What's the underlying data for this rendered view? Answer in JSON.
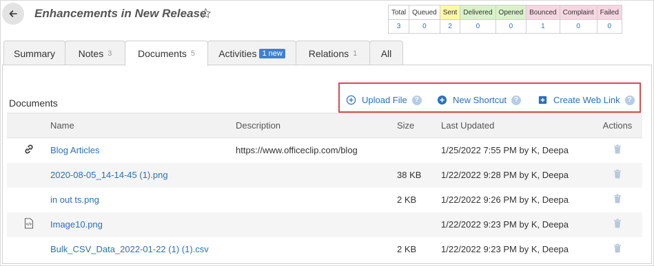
{
  "header": {
    "title": "Enhancements in New Release"
  },
  "stats": {
    "labels": [
      "Total",
      "Queued",
      "Sent",
      "Delivered",
      "Opened",
      "Bounced",
      "Complaint",
      "Failed"
    ],
    "values": [
      "3",
      "0",
      "2",
      "0",
      "0",
      "1",
      "0",
      "0"
    ],
    "colors": [
      "#ffffff",
      "#ffffff",
      "#fff9a6",
      "#d9f2c9",
      "#d9f2c9",
      "#f7d6e2",
      "#f7d6e2",
      "#f7d6e2"
    ]
  },
  "tabs": [
    {
      "label": "Summary",
      "count": ""
    },
    {
      "label": "Notes",
      "count": "3"
    },
    {
      "label": "Documents",
      "count": "5"
    },
    {
      "label": "Activities",
      "badge": "1 new"
    },
    {
      "label": "Relations",
      "count": "1"
    },
    {
      "label": "All",
      "count": ""
    }
  ],
  "documents": {
    "title": "Documents",
    "actions": {
      "upload": "Upload File",
      "shortcut": "New Shortcut",
      "weblink": "Create Web Link"
    },
    "columns": {
      "name": "Name",
      "description": "Description",
      "size": "Size",
      "updated": "Last Updated",
      "actions": "Actions"
    },
    "rows": [
      {
        "icon": "link-icon",
        "name": "Blog Articles",
        "description": "https://www.officeclip.com/blog",
        "size": "",
        "updated": "1/25/2022 7:55 PM by K, Deepa"
      },
      {
        "icon": "",
        "name": "2020-08-05_14-14-45 (1).png",
        "description": "",
        "size": "38 KB",
        "updated": "1/22/2022 9:28 PM by K, Deepa"
      },
      {
        "icon": "",
        "name": "in out ts.png",
        "description": "",
        "size": "2 KB",
        "updated": "1/22/2022 9:26 PM by K, Deepa"
      },
      {
        "icon": "code-file-icon",
        "name": "Image10.png",
        "description": "",
        "size": "",
        "updated": "1/22/2022 9:23 PM by K, Deepa"
      },
      {
        "icon": "",
        "name": "Bulk_CSV_Data_2022-01-22 (1) (1).csv",
        "description": "",
        "size": "2 KB",
        "updated": "1/22/2022 9:23 PM by K, Deepa"
      }
    ]
  }
}
